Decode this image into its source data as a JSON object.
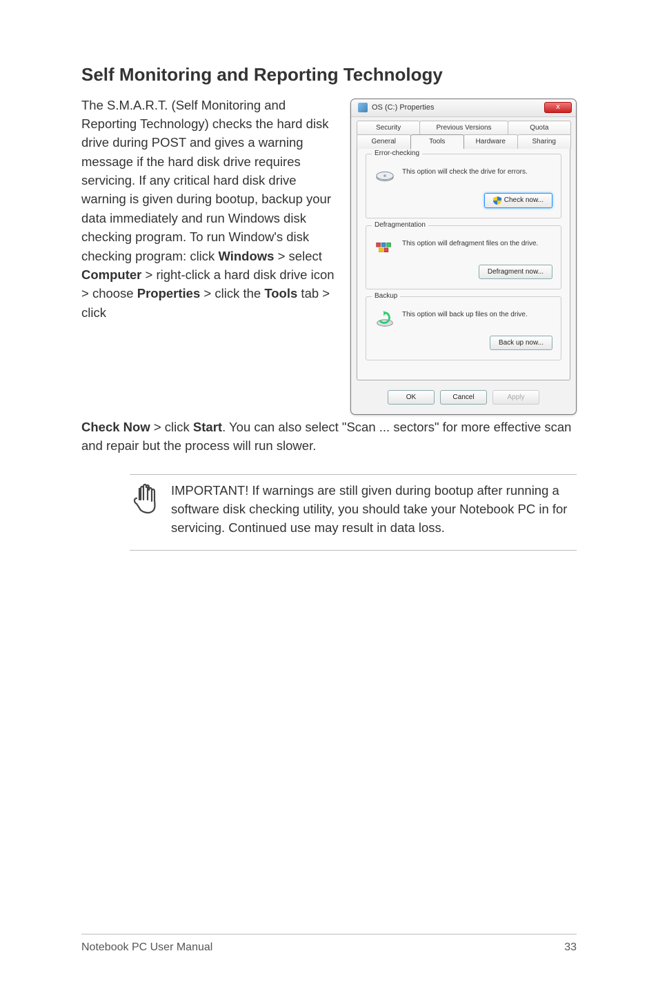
{
  "heading": "Self Monitoring and Reporting Technology",
  "body_part1": "The S.M.A.R.T. (Self Monitoring and Reporting Technology) checks the hard disk drive during POST and gives a warning message if the hard disk drive requires servicing. If any critical hard disk drive warning is given during bootup, backup your data immediately and run Windows disk checking program. To run Window's disk checking program: click ",
  "b1": "Windows",
  "body_part2": " > select ",
  "b2": "Computer",
  "body_part3": " > right-click a hard disk drive icon > choose ",
  "b3": "Properties",
  "body_part4": " > click the ",
  "b4": "Tools",
  "body_part5": " tab > click ",
  "b5": "Check Now",
  "body_part6": " > click ",
  "b6": "Start",
  "body_part7": ". You can also select \"Scan ... sectors\" for more effective scan and repair but the process will run slower.",
  "dialog": {
    "title": "OS (C:) Properties",
    "close": "x",
    "tabs_back": [
      "Security",
      "Previous Versions",
      "Quota"
    ],
    "tabs_front": [
      "General",
      "Tools",
      "Hardware",
      "Sharing"
    ],
    "groups": [
      {
        "legend": "Error-checking",
        "text": "This option will check the drive for errors.",
        "button": "Check now...",
        "highlight": true
      },
      {
        "legend": "Defragmentation",
        "text": "This option will defragment files on the drive.",
        "button": "Defragment now...",
        "highlight": false
      },
      {
        "legend": "Backup",
        "text": "This option will back up files on the drive.",
        "button": "Back up now...",
        "highlight": false
      }
    ],
    "buttons": {
      "ok": "OK",
      "cancel": "Cancel",
      "apply": "Apply"
    }
  },
  "note": "IMPORTANT! If warnings are still given during bootup after running a software disk checking utility, you should take your Notebook PC in for servicing. Continued use may result in data loss.",
  "footer": {
    "left": "Notebook PC User Manual",
    "right": "33"
  }
}
